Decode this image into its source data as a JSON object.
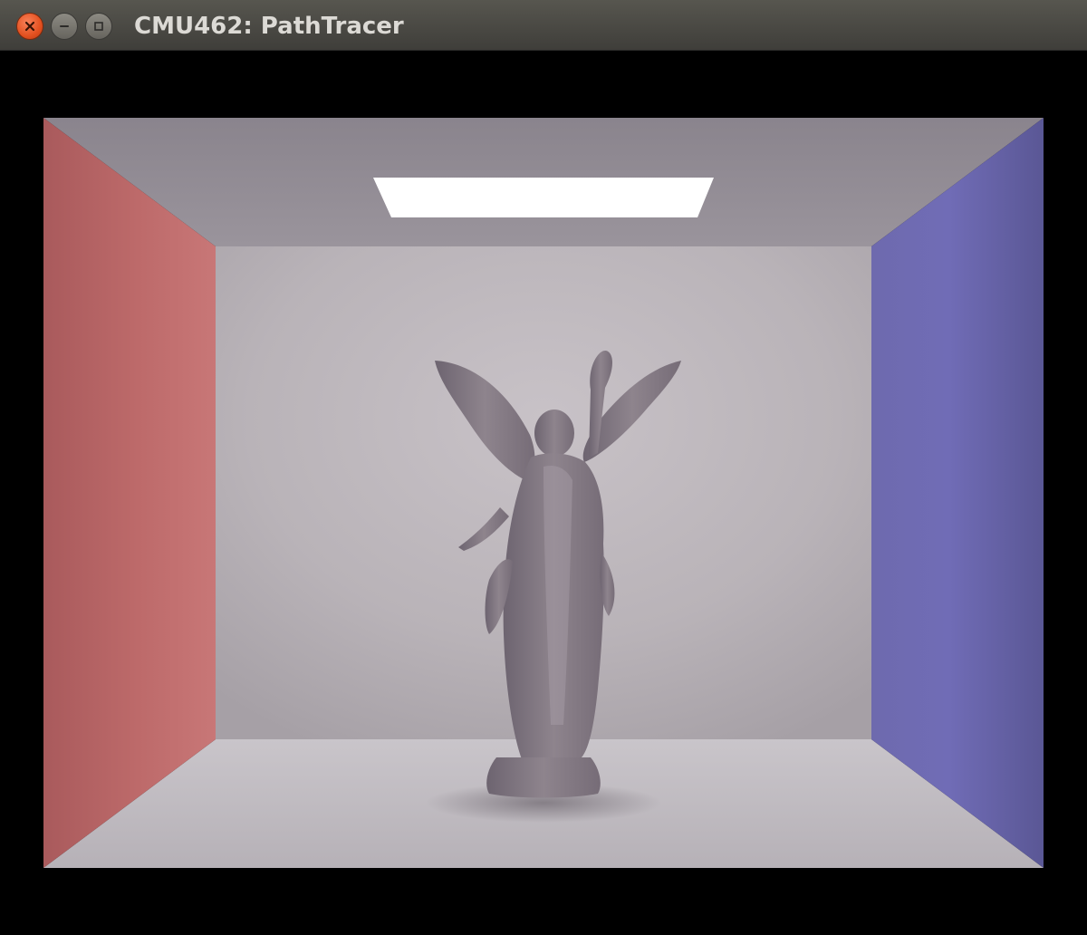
{
  "window": {
    "title": "CMU462: PathTracer",
    "controls": {
      "close_icon": "close-icon",
      "minimize_icon": "minimize-icon",
      "maximize_icon": "maximize-icon"
    }
  },
  "render": {
    "scene": "cornell-box",
    "colors": {
      "left_wall": "#b86566",
      "right_wall": "#6c68b0",
      "back_wall": "#b9b3b8",
      "ceiling": "#8e8890",
      "floor": "#c0bcc2",
      "light": "#ffffff",
      "statue": "#8a8088"
    }
  }
}
